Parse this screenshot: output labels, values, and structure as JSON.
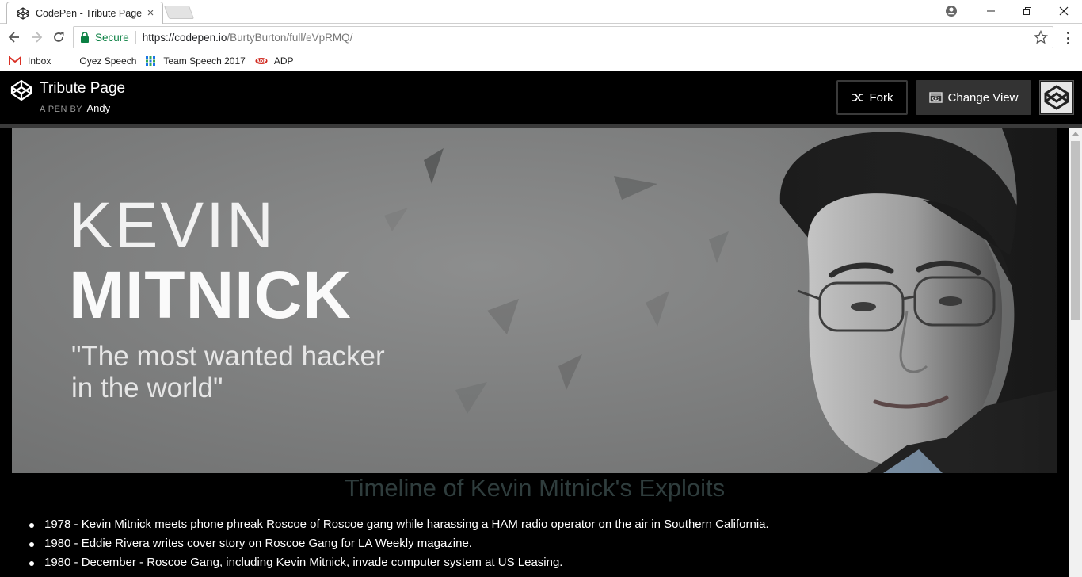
{
  "browser": {
    "tab_title": "CodePen - Tribute Page",
    "tab_close": "×",
    "secure_label": "Secure",
    "url_host": "https://codepen.io",
    "url_path": "/BurtyBurton/full/eVpRMQ/",
    "bookmarks": [
      {
        "label": "Inbox",
        "icon": "gmail-icon"
      },
      {
        "label": "Oyez Speech",
        "icon": "blank-icon"
      },
      {
        "label": "Team Speech 2017",
        "icon": "grid-icon"
      },
      {
        "label": "ADP",
        "icon": "adp-icon"
      }
    ]
  },
  "header": {
    "title": "Tribute Page",
    "sub_prefix": "A PEN BY",
    "author": "Andy",
    "fork_label": "Fork",
    "change_view_label": "Change View"
  },
  "hero": {
    "line1": "KEVIN",
    "line2": "MITNICK",
    "quote_line1": "\"The most wanted hacker",
    "quote_line2": "in the world\""
  },
  "content": {
    "title": "Timeline of Kevin Mitnick's Exploits",
    "timeline": [
      "1978 - Kevin Mitnick meets phone phreak Roscoe of Roscoe gang while harassing a HAM radio operator on the air in Southern California.",
      "1980 - Eddie Rivera writes cover story on Roscoe Gang for LA Weekly magazine.",
      "1980 - December - Roscoe Gang, including Kevin Mitnick, invade computer system at US Leasing."
    ]
  },
  "colors": {
    "secure_green": "#0b8043",
    "header_bg": "#000000",
    "change_view_bg": "#333333",
    "title_color": "#2f3d3d"
  }
}
